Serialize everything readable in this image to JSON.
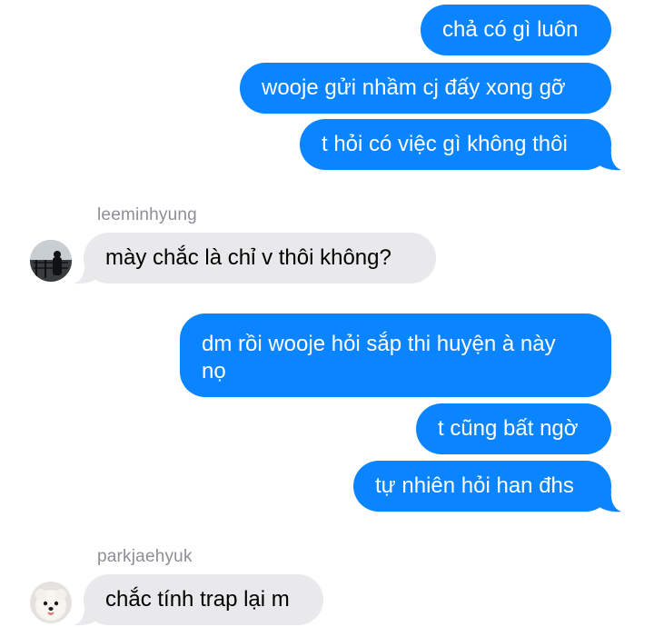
{
  "conversation": {
    "outgoing_1": [
      "chả có gì luôn",
      "wooje gửi nhầm cj đấy xong gỡ",
      "t hỏi có việc gì không thôi"
    ],
    "incoming_1": {
      "sender": "leeminhyung",
      "message": "mày chắc là chỉ v thôi không?"
    },
    "outgoing_2": [
      "dm rồi wooje hỏi sắp thi huyện à này nọ",
      "t cũng bất ngờ",
      "tự nhiên hỏi han đhs"
    ],
    "incoming_2": {
      "sender": "parkjaehyuk",
      "message": "chắc tính trap lại m"
    }
  },
  "colors": {
    "outgoing_bubble": "#0a84ff",
    "incoming_bubble": "#e9e9eb",
    "sender_name": "#8e8e93"
  }
}
